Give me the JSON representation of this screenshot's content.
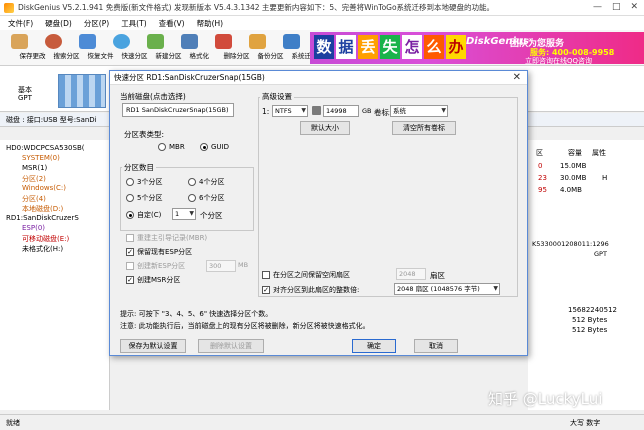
{
  "window": {
    "title": "DiskGenius V5.2.1.941 免费版(新文件格式)   发现新版本 V5.4.3.1342 主要更新内容如下：5、完善将WinToGo系统迁移到本地硬盘的功能。",
    "controls": [
      "—",
      "□",
      "✕"
    ]
  },
  "menu": [
    "文件(F)",
    "硬盘(D)",
    "分区(P)",
    "工具(T)",
    "查看(V)",
    "帮助(H)"
  ],
  "toolbar": [
    {
      "label": "保存更改",
      "color": "#d9a45a"
    },
    {
      "label": "搜索分区",
      "color": "#c75b3c"
    },
    {
      "label": "恢复文件",
      "color": "#4d8bd6"
    },
    {
      "label": "快速分区",
      "color": "#4aa3df"
    },
    {
      "label": "新建分区",
      "color": "#6ab04c"
    },
    {
      "label": "格式化",
      "color": "#4f7fb8"
    },
    {
      "label": "删除分区",
      "color": "#d14b3c"
    },
    {
      "label": "备份分区",
      "color": "#e0a340"
    },
    {
      "label": "系统迁移",
      "color": "#3f7fc7"
    }
  ],
  "banner": {
    "tiles": [
      "数",
      "据",
      "丢",
      "失",
      "怎",
      "么",
      "办"
    ],
    "logo": "DiskGenius",
    "slogan": "团队为您服务",
    "phone": "服务: 400-008-9958",
    "qq": "立即咨询在线QQ咨询"
  },
  "diskbar": {
    "label_top": "基本",
    "label_bottom": "GPT"
  },
  "infobar": "磁盘 : 接口:USB  型号:SanDi",
  "tree": [
    {
      "label": "HD0:WDCPCSA530SB(",
      "cls": ""
    },
    {
      "label": "SYSTEM(0)",
      "cls": "ti-orange"
    },
    {
      "label": "MSR(1)",
      "cls": ""
    },
    {
      "label": "分区(2)",
      "cls": "ti-orange"
    },
    {
      "label": "Windows(C:)",
      "cls": "ti-orange"
    },
    {
      "label": "分区(4)",
      "cls": "ti-orange"
    },
    {
      "label": "本地磁盘(D:)",
      "cls": "ti-orange"
    },
    {
      "label": "RD1:SanDiskCruzerS",
      "cls": ""
    },
    {
      "label": "ESP(0)",
      "cls": "ti-purple"
    },
    {
      "label": "可移动磁盘(E:)",
      "cls": "ti-red"
    },
    {
      "label": "未格式化(H:)",
      "cls": ""
    }
  ],
  "right_panel": {
    "header": {
      "col1": "区",
      "col2": "容量",
      "col3": "属性"
    },
    "rows": [
      {
        "a": "0",
        "b": "15.0MB",
        "c": ""
      },
      {
        "a": "23",
        "b": "30.0MB",
        "c": "H"
      },
      {
        "a": "95",
        "b": "4.0MB",
        "c": ""
      }
    ],
    "guid": "K5330001208011:1296",
    "guid2": "GPT",
    "t1": "15682240512",
    "t2": "512 Bytes",
    "t3": "512 Bytes"
  },
  "statusbar": {
    "left": "就绪",
    "right": "大写  数字"
  },
  "watermark": "知乎 @LuckyLui",
  "dialog": {
    "title": "快速分区   RD1:SanDiskCruzerSnap(15GB)",
    "close": "✕",
    "current_disk_label": "当前磁盘(点击选择)",
    "current_disk_value": "RD1 SanDiskCruzerSnap(15GB)",
    "partition_type_label": "分区表类型:",
    "type_mbr": "MBR",
    "type_guid": "GUID",
    "count_label": "分区数目",
    "counts": [
      "3个分区",
      "4个分区",
      "5个分区",
      "6个分区"
    ],
    "custom_label": "自定(C)",
    "custom_value": "1",
    "custom_unit": "个分区",
    "rebuild_mbr": "重建主引导记录(MBR)",
    "keep_esp": "保留现有ESP分区",
    "create_esp": "创建新ESP分区",
    "esp_size": "300",
    "esp_unit": "MB",
    "create_msr": "创建MSR分区",
    "advanced_label": "高级设置",
    "part_index": "1:",
    "fs": "NTFS",
    "size": "14998",
    "size_unit": "GB",
    "vol_label_text": "卷标:",
    "vol_label_value": "系统",
    "default_size_btn": "默认大小",
    "clear_labels_btn": "清空所有卷标",
    "free_between": "在分区之间保留空闲扇区",
    "free_value": "2048",
    "free_unit": "扇区",
    "align_label": "对齐分区到此扇区的整数倍:",
    "align_value": "2048 扇区 (1048576 字节)",
    "tip1": "提示:   可按下 \"3、4、5、6\" 快速选择分区个数。",
    "tip2": "注意:   此功能执行后，当前磁盘上的现有分区将被删除，新分区将被快速格式化。",
    "save_default_btn": "保存为默认设置",
    "delete_default_btn": "删除默认设置",
    "ok_btn": "确定",
    "cancel_btn": "取消"
  }
}
